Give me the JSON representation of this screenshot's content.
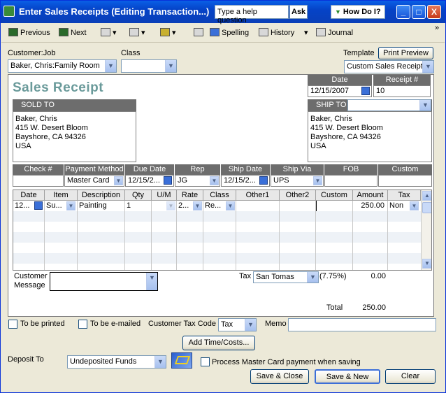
{
  "window": {
    "title": "Enter Sales Receipts (Editing Transaction...)",
    "help_placeholder": "Type a help question",
    "ask_label": "Ask",
    "howdoi_label": "How Do I?",
    "min_glyph": "_",
    "max_glyph": "□",
    "close_glyph": "X"
  },
  "toolbar": {
    "previous": "Previous",
    "next": "Next",
    "spelling": "Spelling",
    "history": "History",
    "journal": "Journal",
    "more": "»"
  },
  "header": {
    "customer_job_label": "Customer:Job",
    "customer_job_value": "Baker, Chris:Family Room",
    "class_label": "Class",
    "class_value": "",
    "template_label": "Template",
    "print_preview": "Print Preview",
    "template_value": "Custom Sales Receipt"
  },
  "form": {
    "title": "Sales Receipt",
    "date_label": "Date",
    "date_value": "12/15/2007",
    "receipt_label": "Receipt #",
    "receipt_value": "10",
    "sold_to_label": "SOLD TO",
    "sold_to_lines": [
      "Baker, Chris",
      "415 W. Desert Bloom",
      "Bayshore, CA  94326",
      "USA"
    ],
    "ship_to_label": "SHIP TO",
    "ship_to_lines": [
      "Baker, Chris",
      "415 W. Desert Bloom",
      "Bayshore, CA  94326",
      "USA"
    ],
    "fields": [
      {
        "label": "Check #",
        "value": ""
      },
      {
        "label": "Payment Method",
        "value": "Master Card"
      },
      {
        "label": "Due Date",
        "value": "12/15/2..."
      },
      {
        "label": "Rep",
        "value": "JG"
      },
      {
        "label": "Ship Date",
        "value": "12/15/2..."
      },
      {
        "label": "Ship Via",
        "value": "UPS"
      },
      {
        "label": "FOB",
        "value": ""
      },
      {
        "label": "Custom",
        "value": ""
      }
    ],
    "columns": [
      "Date",
      "Item",
      "Description",
      "Qty",
      "U/M",
      "Rate",
      "Class",
      "Other1",
      "Other2",
      "Custom",
      "Amount",
      "Tax"
    ],
    "rows": [
      {
        "date": "12...",
        "item": "Su...",
        "description": "Painting",
        "qty": "1",
        "um": "",
        "rate": "2...",
        "class": "Re...",
        "other1": "",
        "other2": "",
        "custom": "",
        "amount": "250.00",
        "tax": "Non"
      }
    ],
    "customer_message_label_1": "Customer",
    "customer_message_label_2": "Message",
    "tax_label": "Tax",
    "tax_item": "San Tomas",
    "tax_rate": "(7.75%)",
    "tax_amount": "0.00",
    "total_label": "Total",
    "total_amount": "250.00"
  },
  "footer": {
    "to_be_printed": "To be printed",
    "to_be_emailed": "To be e-mailed",
    "tax_code_label": "Customer Tax Code",
    "tax_code_value": "Tax",
    "memo_label": "Memo",
    "memo_value": "",
    "add_time_costs": "Add Time/Costs...",
    "deposit_to_label": "Deposit To",
    "deposit_to_value": "Undeposited Funds",
    "process_cc": "Process Master Card payment when saving",
    "save_close": "Save & Close",
    "save_new": "Save & New",
    "clear": "Clear"
  }
}
